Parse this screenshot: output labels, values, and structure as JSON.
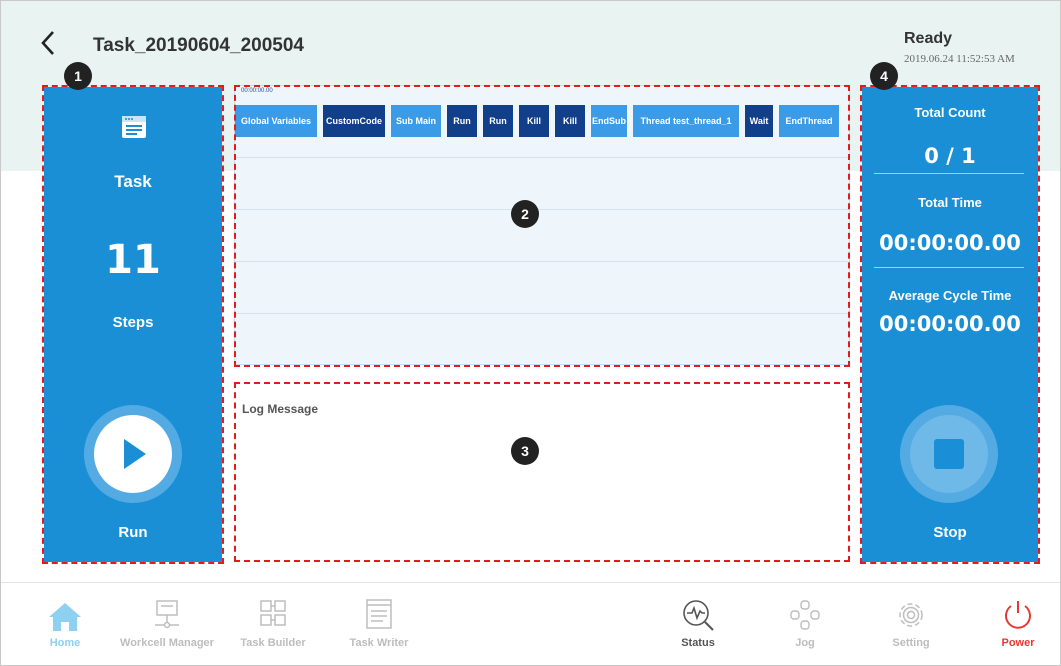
{
  "header": {
    "back_icon": "chevron-left-icon",
    "title": "Task_20190604_200504",
    "status": "Ready",
    "datetime": "2019.06.24 11:52:53 AM"
  },
  "left_panel": {
    "icon": "document-list-icon",
    "task_label": "Task",
    "steps_count": "11",
    "steps_label": "Steps",
    "run_label": "Run",
    "run_icon": "play-icon"
  },
  "timeline": {
    "time": "00:00:00.00",
    "blocks": [
      {
        "label": "Global Variables",
        "style": "light"
      },
      {
        "label": "CustomCode",
        "style": "dark"
      },
      {
        "label": "Sub Main",
        "style": "light"
      },
      {
        "label": "Run",
        "style": "dark"
      },
      {
        "label": "Run",
        "style": "dark"
      },
      {
        "label": "Kill",
        "style": "dark"
      },
      {
        "label": "Kill",
        "style": "dark"
      },
      {
        "label": "EndSub",
        "style": "light"
      },
      {
        "label": "Thread test_thread_1",
        "style": "light"
      },
      {
        "label": "Wait",
        "style": "dark"
      },
      {
        "label": "EndThread",
        "style": "light"
      }
    ]
  },
  "log": {
    "label": "Log Message"
  },
  "right_panel": {
    "total_count_label": "Total Count",
    "total_count_value": "0 / 1",
    "total_time_label": "Total Time",
    "total_time_value": "00:00:00.00",
    "avg_cycle_label": "Average Cycle Time",
    "avg_cycle_value": "00:00:00.00",
    "stop_label": "Stop",
    "stop_icon": "stop-icon"
  },
  "markers": [
    "1",
    "2",
    "3",
    "4"
  ],
  "nav": {
    "items": [
      {
        "label": "Home",
        "icon": "home-icon",
        "color": "#8dd0f0"
      },
      {
        "label": "Workcell Manager",
        "icon": "workcell-icon",
        "color": "#bdbdbd"
      },
      {
        "label": "Task Builder",
        "icon": "task-builder-icon",
        "color": "#bdbdbd"
      },
      {
        "label": "Task Writer",
        "icon": "task-writer-icon",
        "color": "#bdbdbd"
      },
      {
        "label": "Status",
        "icon": "status-icon",
        "color": "#555555"
      },
      {
        "label": "Jog",
        "icon": "jog-icon",
        "color": "#bdbdbd"
      },
      {
        "label": "Setting",
        "icon": "gear-icon",
        "color": "#bdbdbd"
      },
      {
        "label": "Power",
        "icon": "power-icon",
        "color": "#e53935"
      }
    ]
  },
  "colors": {
    "panel_blue": "#1a8fd6",
    "block_light": "#3c9be6",
    "block_dark": "#123f8a",
    "highlight_dash": "#e51b1b",
    "header_band": "#e9f4f2"
  }
}
